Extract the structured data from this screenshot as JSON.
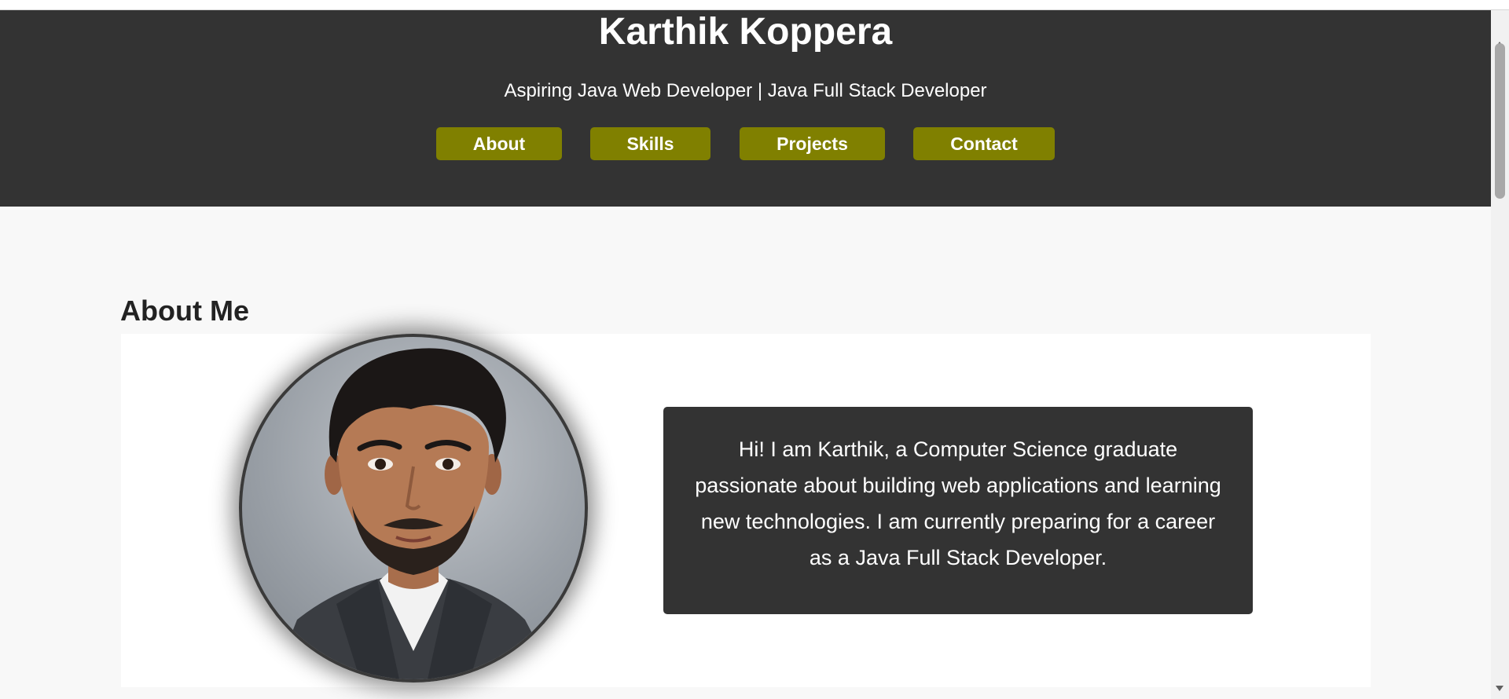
{
  "header": {
    "name": "Karthik Koppera",
    "tagline": "Aspiring Java Web Developer | Java Full Stack Developer",
    "nav": [
      {
        "label": "About"
      },
      {
        "label": "Skills"
      },
      {
        "label": "Projects"
      },
      {
        "label": "Contact"
      }
    ]
  },
  "about": {
    "heading": "About Me",
    "bio": "Hi! I am Karthik, a Computer Science graduate passionate about building web applications and learning new technologies. I am currently preparing for a career as a Java Full Stack Developer."
  },
  "colors": {
    "header_bg": "#333333",
    "nav_button": "#808000",
    "page_bg": "#f8f8f8"
  }
}
